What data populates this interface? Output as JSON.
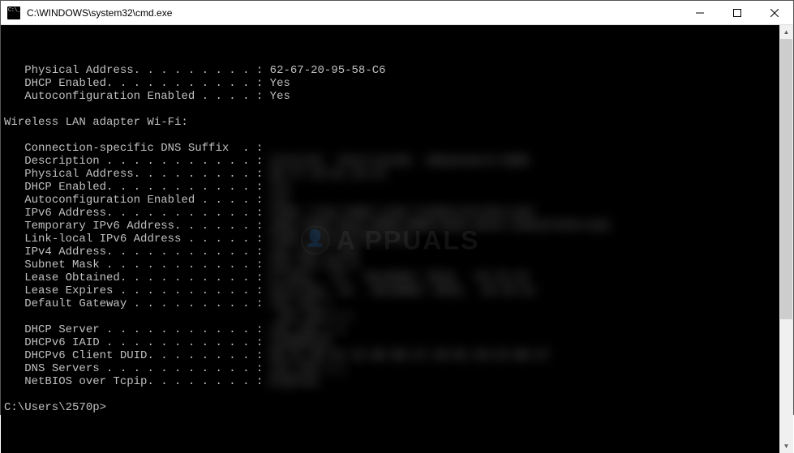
{
  "window": {
    "title": "C:\\WINDOWS\\system32\\cmd.exe"
  },
  "watermark": {
    "text": "A PPUALS"
  },
  "terminal": {
    "lines": [
      {
        "indent": "   ",
        "label": "Physical Address. . . . . . . . . :",
        "value": " 62-67-20-95-58-C6",
        "blur": false
      },
      {
        "indent": "   ",
        "label": "DHCP Enabled. . . . . . . . . . . :",
        "value": " Yes",
        "blur": false
      },
      {
        "indent": "   ",
        "label": "Autoconfiguration Enabled . . . . :",
        "value": " Yes",
        "blur": false
      },
      {
        "indent": "",
        "label": "",
        "value": "",
        "blur": false
      },
      {
        "indent": "",
        "label": "Wireless LAN adapter Wi-Fi:",
        "value": "",
        "blur": false
      },
      {
        "indent": "",
        "label": "",
        "value": "",
        "blur": false
      },
      {
        "indent": "   ",
        "label": "Connection-specific DNS Suffix  . :",
        "value": "",
        "blur": false
      },
      {
        "indent": "   ",
        "label": "Description . . . . . . . . . . . :",
        "value": " Intel(R)  Centrino(R)  Advanced-N 6205",
        "blur": true
      },
      {
        "indent": "   ",
        "label": "Physical Address. . . . . . . . . :",
        "value": " 00-27-10-01-10-C3",
        "blur": true
      },
      {
        "indent": "   ",
        "label": "DHCP Enabled. . . . . . . . . . . :",
        "value": " Yes",
        "blur": true
      },
      {
        "indent": "   ",
        "label": "Autoconfiguration Enabled . . . . :",
        "value": " Yes",
        "blur": true
      },
      {
        "indent": "   ",
        "label": "IPv6 Address. . . . . . . . . . . :",
        "value": " fe80::712e:5303:1128:7145%11(Preferred)",
        "blur": true
      },
      {
        "indent": "   ",
        "label": "Temporary IPv6 Address. . . . . . :",
        "value": " 2001:0db8:85a3:0000:0000:8a2e:0370:7334(Preferred)",
        "blur": true
      },
      {
        "indent": "   ",
        "label": "Link-local IPv6 Address . . . . . :",
        "value": " fe80::1%11(Preferred)",
        "blur": true
      },
      {
        "indent": "   ",
        "label": "IPv4 Address. . . . . . . . . . . :",
        "value": " 192.168.1.105",
        "blur": true
      },
      {
        "indent": "   ",
        "label": "Subnet Mask . . . . . . . . . . . :",
        "value": " 255.255.255.0",
        "blur": true
      },
      {
        "indent": "   ",
        "label": "Lease Obtained. . . . . . . . . . :",
        "value": " Friday,  15.  November 2019,  10:15:42",
        "blur": true
      },
      {
        "indent": "   ",
        "label": "Lease Expires . . . . . . . . . . :",
        "value": " Saturday, 16.  November 2019,  10:15:41",
        "blur": true
      },
      {
        "indent": "   ",
        "label": "Default Gateway . . . . . . . . . :",
        "value": " 192.168.1",
        "blur": true
      },
      {
        "indent": "   ",
        "label": "",
        "value": "                                     192.168.1.1",
        "blur": true
      },
      {
        "indent": "   ",
        "label": "DHCP Server . . . . . . . . . . . :",
        "value": " 192.168.1.1",
        "blur": true
      },
      {
        "indent": "   ",
        "label": "DHCPv6 IAID . . . . . . . . . . . :",
        "value": " 234889216",
        "blur": true
      },
      {
        "indent": "   ",
        "label": "DHCPv6 Client DUID. . . . . . . . :",
        "value": " 00-01-00-01-1C-AE-00-27-10-01-10-C3-00-27",
        "blur": true
      },
      {
        "indent": "   ",
        "label": "DNS Servers . . . . . . . . . . . :",
        "value": " 192.168.1.1",
        "blur": true
      },
      {
        "indent": "   ",
        "label": "NetBIOS over Tcpip. . . . . . . . :",
        "value": " Enabled",
        "blur": true
      }
    ],
    "prompt": "C:\\Users\\2570p>"
  }
}
